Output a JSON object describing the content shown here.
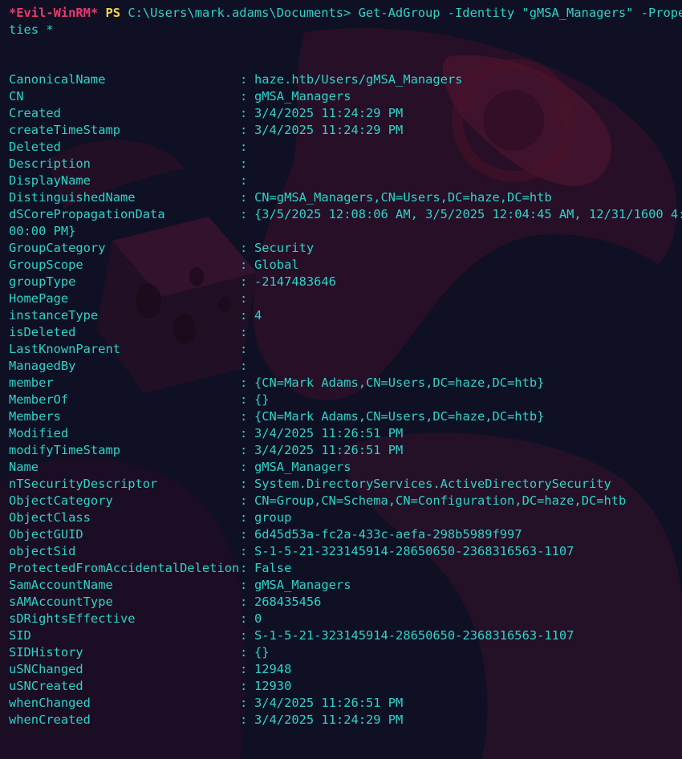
{
  "prompt": {
    "shell_name": "*Evil-WinRM*",
    "ps": "PS",
    "path": "C:\\Users\\mark.adams\\Documents>",
    "command_line1": "Get-AdGroup -Identity \"gMSA_Managers\" -Proper",
    "command_line2": "ties *"
  },
  "rows": [
    {
      "key": "CanonicalName",
      "value": "haze.htb/Users/gMSA_Managers"
    },
    {
      "key": "CN",
      "value": "gMSA_Managers"
    },
    {
      "key": "Created",
      "value": "3/4/2025 11:24:29 PM"
    },
    {
      "key": "createTimeStamp",
      "value": "3/4/2025 11:24:29 PM"
    },
    {
      "key": "Deleted",
      "value": ""
    },
    {
      "key": "Description",
      "value": ""
    },
    {
      "key": "DisplayName",
      "value": ""
    },
    {
      "key": "DistinguishedName",
      "value": "CN=gMSA_Managers,CN=Users,DC=haze,DC=htb"
    },
    {
      "key": "dSCorePropagationData",
      "value": "{3/5/2025 12:08:06 AM, 3/5/2025 12:04:45 AM, 12/31/1600 4:"
    },
    {
      "key": "",
      "value": "00:00 PM}",
      "continuation": true
    },
    {
      "key": "GroupCategory",
      "value": "Security"
    },
    {
      "key": "GroupScope",
      "value": "Global"
    },
    {
      "key": "groupType",
      "value": "-2147483646"
    },
    {
      "key": "HomePage",
      "value": ""
    },
    {
      "key": "instanceType",
      "value": "4"
    },
    {
      "key": "isDeleted",
      "value": ""
    },
    {
      "key": "LastKnownParent",
      "value": ""
    },
    {
      "key": "ManagedBy",
      "value": ""
    },
    {
      "key": "member",
      "value": "{CN=Mark Adams,CN=Users,DC=haze,DC=htb}"
    },
    {
      "key": "MemberOf",
      "value": "{}"
    },
    {
      "key": "Members",
      "value": "{CN=Mark Adams,CN=Users,DC=haze,DC=htb}"
    },
    {
      "key": "Modified",
      "value": "3/4/2025 11:26:51 PM"
    },
    {
      "key": "modifyTimeStamp",
      "value": "3/4/2025 11:26:51 PM"
    },
    {
      "key": "Name",
      "value": "gMSA_Managers"
    },
    {
      "key": "nTSecurityDescriptor",
      "value": "System.DirectoryServices.ActiveDirectorySecurity"
    },
    {
      "key": "ObjectCategory",
      "value": "CN=Group,CN=Schema,CN=Configuration,DC=haze,DC=htb"
    },
    {
      "key": "ObjectClass",
      "value": "group"
    },
    {
      "key": "ObjectGUID",
      "value": "6d45d53a-fc2a-433c-aefa-298b5989f997"
    },
    {
      "key": "objectSid",
      "value": "S-1-5-21-323145914-28650650-2368316563-1107"
    },
    {
      "key": "ProtectedFromAccidentalDeletion",
      "value": "False"
    },
    {
      "key": "SamAccountName",
      "value": "gMSA_Managers"
    },
    {
      "key": "sAMAccountType",
      "value": "268435456"
    },
    {
      "key": "sDRightsEffective",
      "value": "0"
    },
    {
      "key": "SID",
      "value": "S-1-5-21-323145914-28650650-2368316563-1107"
    },
    {
      "key": "SIDHistory",
      "value": "{}"
    },
    {
      "key": "uSNChanged",
      "value": "12948"
    },
    {
      "key": "uSNCreated",
      "value": "12930"
    },
    {
      "key": "whenChanged",
      "value": "3/4/2025 11:26:51 PM"
    },
    {
      "key": "whenCreated",
      "value": "3/4/2025 11:24:29 PM"
    }
  ],
  "separator": ":",
  "colors": {
    "background": "#0f1024",
    "text": "#2ed3c8",
    "prompt_shell": "#e83b6e",
    "prompt_ps": "#f5d74a"
  }
}
